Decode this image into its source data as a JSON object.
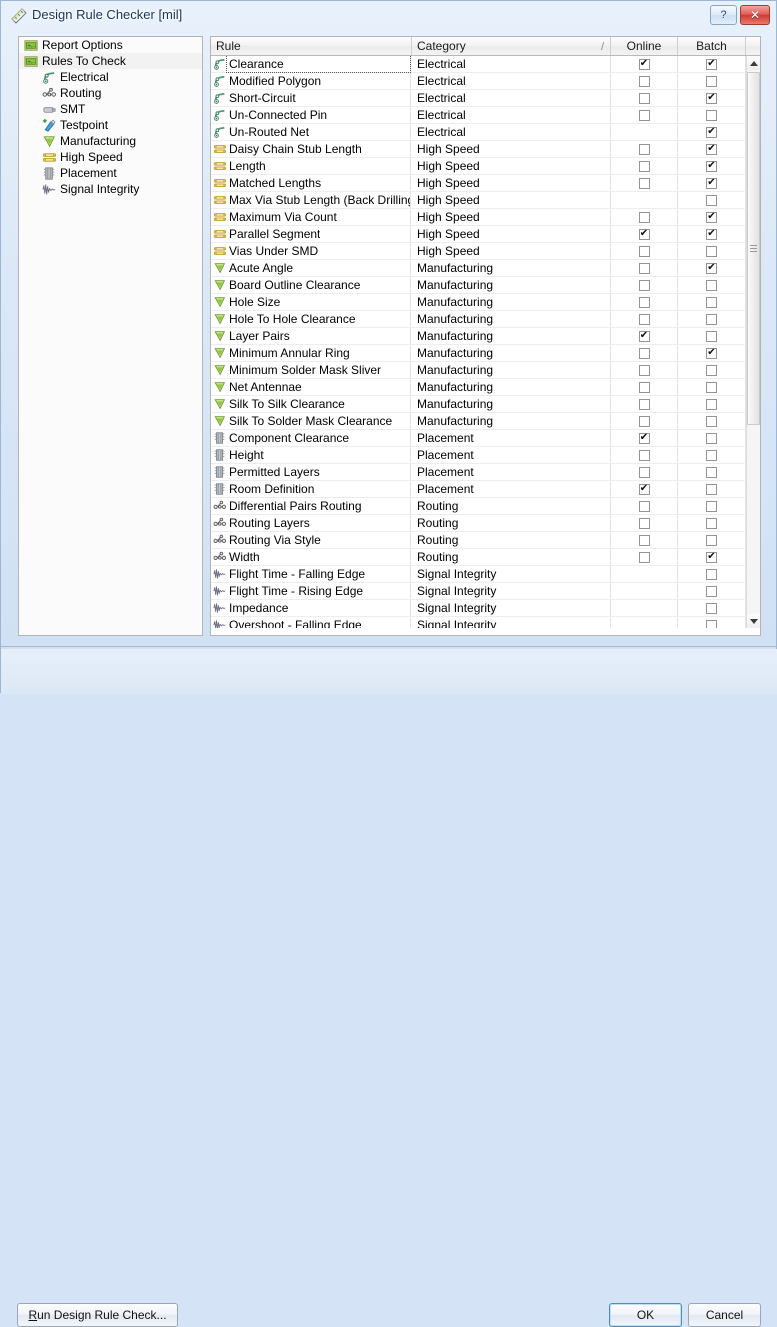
{
  "window": {
    "title": "Design Rule Checker [mil]",
    "icon": "ruler-icon",
    "help_button": "?",
    "close_button": "✕"
  },
  "sidebar": {
    "items": [
      {
        "label": "Report Options",
        "icon": "folder-green-icon",
        "level": 0,
        "selected": false
      },
      {
        "label": "Rules To Check",
        "icon": "folder-green-icon",
        "level": 0,
        "selected": true
      },
      {
        "label": "Electrical",
        "icon": "electrical-icon",
        "level": 1,
        "selected": false
      },
      {
        "label": "Routing",
        "icon": "routing-icon",
        "level": 1,
        "selected": false
      },
      {
        "label": "SMT",
        "icon": "smt-icon",
        "level": 1,
        "selected": false
      },
      {
        "label": "Testpoint",
        "icon": "testpoint-icon",
        "level": 1,
        "selected": false
      },
      {
        "label": "Manufacturing",
        "icon": "manufacturing-icon",
        "level": 1,
        "selected": false
      },
      {
        "label": "High Speed",
        "icon": "highspeed-icon",
        "level": 1,
        "selected": false
      },
      {
        "label": "Placement",
        "icon": "placement-icon",
        "level": 1,
        "selected": false
      },
      {
        "label": "Signal Integrity",
        "icon": "signal-integrity-icon",
        "level": 1,
        "selected": false
      }
    ]
  },
  "table": {
    "columns": [
      {
        "label": "Rule",
        "key": "rule"
      },
      {
        "label": "Category",
        "key": "category",
        "sort_indicator": "/"
      },
      {
        "label": "Online",
        "key": "online"
      },
      {
        "label": "Batch",
        "key": "batch"
      }
    ],
    "rows": [
      {
        "rule": "Clearance",
        "category": "Electrical",
        "icon": "electrical-icon",
        "online": true,
        "batch": true,
        "focused": true
      },
      {
        "rule": "Modified Polygon",
        "category": "Electrical",
        "icon": "electrical-icon",
        "online": false,
        "batch": false
      },
      {
        "rule": "Short-Circuit",
        "category": "Electrical",
        "icon": "electrical-icon",
        "online": false,
        "batch": true
      },
      {
        "rule": "Un-Connected Pin",
        "category": "Electrical",
        "icon": "electrical-icon",
        "online": false,
        "batch": false
      },
      {
        "rule": "Un-Routed Net",
        "category": "Electrical",
        "icon": "electrical-icon",
        "online": null,
        "batch": true
      },
      {
        "rule": "Daisy Chain Stub Length",
        "category": "High Speed",
        "icon": "highspeed-icon",
        "online": false,
        "batch": true
      },
      {
        "rule": "Length",
        "category": "High Speed",
        "icon": "highspeed-icon",
        "online": false,
        "batch": true
      },
      {
        "rule": "Matched Lengths",
        "category": "High Speed",
        "icon": "highspeed-icon",
        "online": false,
        "batch": true
      },
      {
        "rule": "Max Via Stub Length (Back Drilling)",
        "category": "High Speed",
        "icon": "highspeed-icon",
        "online": null,
        "batch": false
      },
      {
        "rule": "Maximum Via Count",
        "category": "High Speed",
        "icon": "highspeed-icon",
        "online": false,
        "batch": true
      },
      {
        "rule": "Parallel Segment",
        "category": "High Speed",
        "icon": "highspeed-icon",
        "online": true,
        "batch": true
      },
      {
        "rule": "Vias Under SMD",
        "category": "High Speed",
        "icon": "highspeed-icon",
        "online": false,
        "batch": false
      },
      {
        "rule": "Acute Angle",
        "category": "Manufacturing",
        "icon": "manufacturing-icon",
        "online": false,
        "batch": true
      },
      {
        "rule": "Board Outline Clearance",
        "category": "Manufacturing",
        "icon": "manufacturing-icon",
        "online": false,
        "batch": false
      },
      {
        "rule": "Hole Size",
        "category": "Manufacturing",
        "icon": "manufacturing-icon",
        "online": false,
        "batch": false
      },
      {
        "rule": "Hole To Hole Clearance",
        "category": "Manufacturing",
        "icon": "manufacturing-icon",
        "online": false,
        "batch": false
      },
      {
        "rule": "Layer Pairs",
        "category": "Manufacturing",
        "icon": "manufacturing-icon",
        "online": true,
        "batch": false
      },
      {
        "rule": "Minimum Annular Ring",
        "category": "Manufacturing",
        "icon": "manufacturing-icon",
        "online": false,
        "batch": true
      },
      {
        "rule": "Minimum Solder Mask Sliver",
        "category": "Manufacturing",
        "icon": "manufacturing-icon",
        "online": false,
        "batch": false
      },
      {
        "rule": "Net Antennae",
        "category": "Manufacturing",
        "icon": "manufacturing-icon",
        "online": false,
        "batch": false
      },
      {
        "rule": "Silk To Silk Clearance",
        "category": "Manufacturing",
        "icon": "manufacturing-icon",
        "online": false,
        "batch": false
      },
      {
        "rule": "Silk To Solder Mask Clearance",
        "category": "Manufacturing",
        "icon": "manufacturing-icon",
        "online": false,
        "batch": false
      },
      {
        "rule": "Component Clearance",
        "category": "Placement",
        "icon": "placement-icon",
        "online": true,
        "batch": false
      },
      {
        "rule": "Height",
        "category": "Placement",
        "icon": "placement-icon",
        "online": false,
        "batch": false
      },
      {
        "rule": "Permitted Layers",
        "category": "Placement",
        "icon": "placement-icon",
        "online": false,
        "batch": false
      },
      {
        "rule": "Room Definition",
        "category": "Placement",
        "icon": "placement-icon",
        "online": true,
        "batch": false
      },
      {
        "rule": "Differential Pairs Routing",
        "category": "Routing",
        "icon": "routing-icon",
        "online": false,
        "batch": false
      },
      {
        "rule": "Routing Layers",
        "category": "Routing",
        "icon": "routing-icon",
        "online": false,
        "batch": false
      },
      {
        "rule": "Routing Via Style",
        "category": "Routing",
        "icon": "routing-icon",
        "online": false,
        "batch": false
      },
      {
        "rule": "Width",
        "category": "Routing",
        "icon": "routing-icon",
        "online": false,
        "batch": true
      },
      {
        "rule": "Flight Time - Falling Edge",
        "category": "Signal Integrity",
        "icon": "signal-integrity-icon",
        "online": null,
        "batch": false
      },
      {
        "rule": "Flight Time - Rising Edge",
        "category": "Signal Integrity",
        "icon": "signal-integrity-icon",
        "online": null,
        "batch": false
      },
      {
        "rule": "Impedance",
        "category": "Signal Integrity",
        "icon": "signal-integrity-icon",
        "online": null,
        "batch": false
      },
      {
        "rule": "Overshoot - Falling Edge",
        "category": "Signal Integrity",
        "icon": "signal-integrity-icon",
        "online": null,
        "batch": false
      }
    ]
  },
  "scrollbar": {
    "up_arrow": "▲",
    "down_arrow": "▼"
  },
  "footer": {
    "run_button": "Run Design Rule Check...",
    "run_button_accel": "R",
    "ok_button": "OK",
    "cancel_button": "Cancel"
  },
  "colors": {
    "title_text": "#17335c",
    "close_button": "#cf3b32",
    "ok_border": "#4d8ebd",
    "electrical_icon": "#3f8f6f",
    "highspeed_icon": "#d9b43a",
    "manufacturing_icon": "#8cc63f",
    "placement_icon": "#8a8a8a",
    "signal_icon": "#6d6d8a"
  }
}
